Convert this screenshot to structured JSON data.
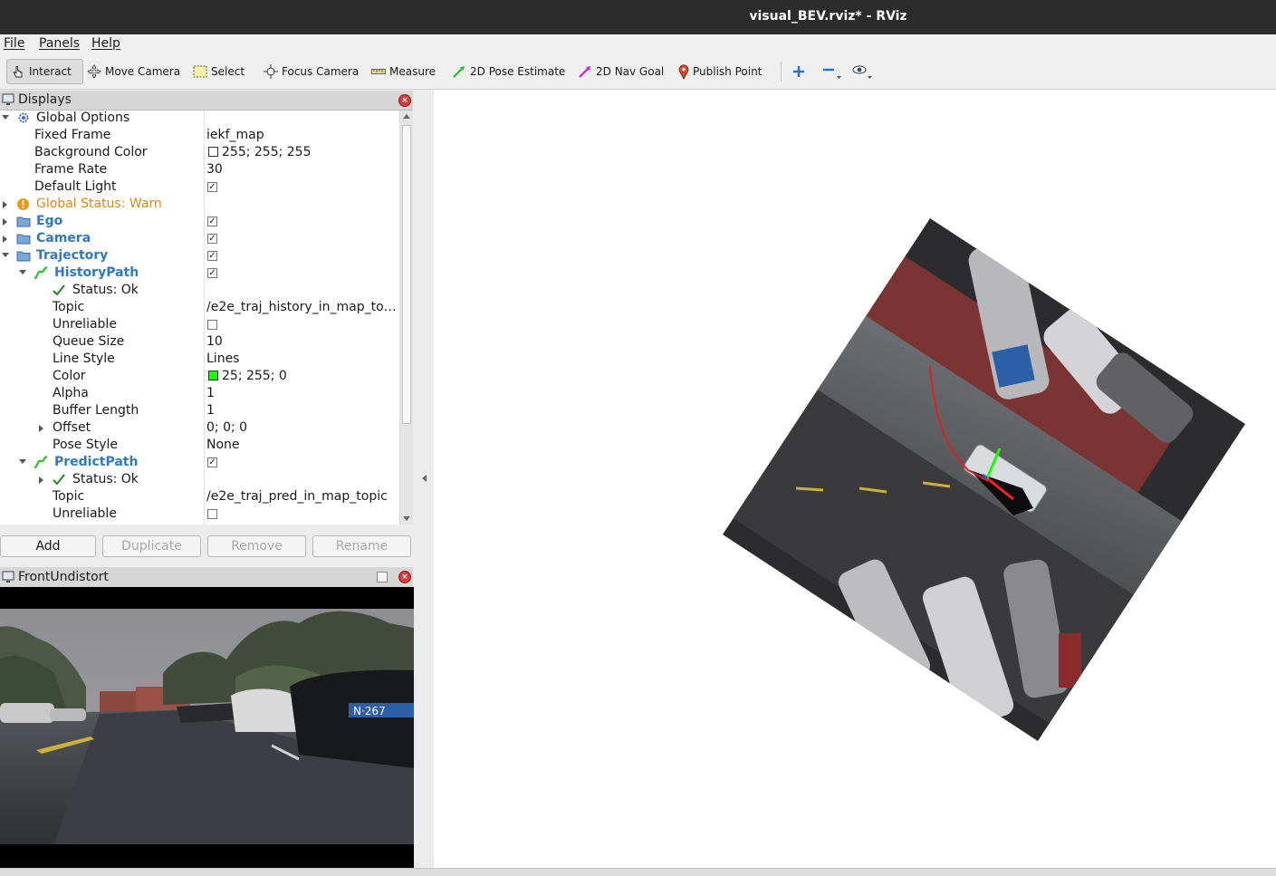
{
  "window": {
    "title": "visual_BEV.rviz* - RViz"
  },
  "menu": [
    "File",
    "Panels",
    "Help"
  ],
  "toolbar": {
    "interact": "Interact",
    "move_camera": "Move Camera",
    "select": "Select",
    "focus_camera": "Focus Camera",
    "measure": "Measure",
    "pose_estimate": "2D Pose Estimate",
    "nav_goal": "2D Nav Goal",
    "publish_point": "Publish Point"
  },
  "displays_panel": {
    "title": "Displays",
    "rows": [
      {
        "name": "Global Options",
        "value": ""
      },
      {
        "name": "Fixed Frame",
        "value": "iekf_map"
      },
      {
        "name": "Background Color",
        "value": "255; 255; 255"
      },
      {
        "name": "Frame Rate",
        "value": "30"
      },
      {
        "name": "Default Light",
        "value": ""
      },
      {
        "name": "Global Status: Warn",
        "value": ""
      },
      {
        "name": "Ego",
        "value": ""
      },
      {
        "name": "Camera",
        "value": ""
      },
      {
        "name": "Trajectory",
        "value": ""
      },
      {
        "name": "HistoryPath",
        "value": ""
      },
      {
        "name": "Status: Ok",
        "value": ""
      },
      {
        "name": "Topic",
        "value": "/e2e_traj_history_in_map_to…"
      },
      {
        "name": "Unreliable",
        "value": ""
      },
      {
        "name": "Queue Size",
        "value": "10"
      },
      {
        "name": "Line Style",
        "value": "Lines"
      },
      {
        "name": "Color",
        "value": "25; 255; 0"
      },
      {
        "name": "Alpha",
        "value": "1"
      },
      {
        "name": "Buffer Length",
        "value": "1"
      },
      {
        "name": "Offset",
        "value": "0; 0; 0"
      },
      {
        "name": "Pose Style",
        "value": "None"
      },
      {
        "name": "PredictPath",
        "value": ""
      },
      {
        "name": "Status: Ok",
        "value": ""
      },
      {
        "name": "Topic",
        "value": "/e2e_traj_pred_in_map_topic"
      },
      {
        "name": "Unreliable",
        "value": ""
      }
    ],
    "buttons": {
      "add": "Add",
      "duplicate": "Duplicate",
      "remove": "Remove",
      "rename": "Rename"
    }
  },
  "image_panel": {
    "title": "FrontUndistort",
    "plate_text": "N·267"
  },
  "colors": {
    "history_path": "#19ff00",
    "warn": "#d68a14",
    "display_name": "#2f78c4"
  }
}
